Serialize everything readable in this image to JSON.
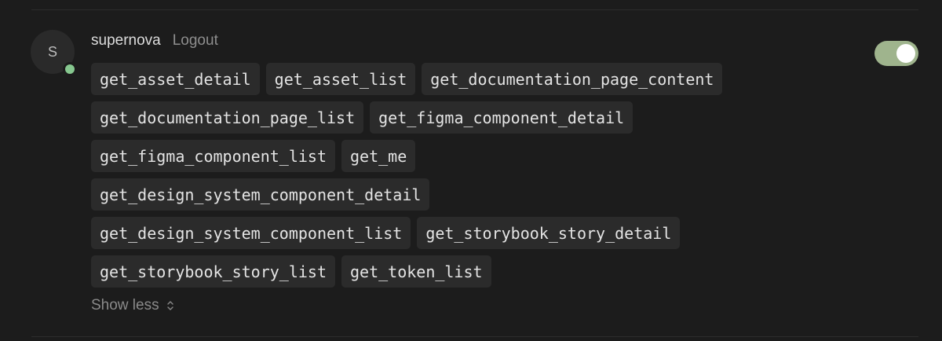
{
  "user": {
    "avatar_initial": "S",
    "name": "supernova",
    "logout_label": "Logout",
    "status": "online",
    "status_color": "#86c78f"
  },
  "toggle": {
    "state": "on",
    "color": "#9fb48d"
  },
  "tools": [
    [
      "get_asset_detail",
      "get_asset_list",
      "get_documentation_page_content"
    ],
    [
      "get_documentation_page_list",
      "get_figma_component_detail"
    ],
    [
      "get_figma_component_list",
      "get_me"
    ],
    [
      "get_design_system_component_detail"
    ],
    [
      "get_design_system_component_list",
      "get_storybook_story_detail"
    ],
    [
      "get_storybook_story_list",
      "get_token_list"
    ]
  ],
  "show_less_label": "Show less",
  "show_less_icon": "chevron-up-down-icon"
}
